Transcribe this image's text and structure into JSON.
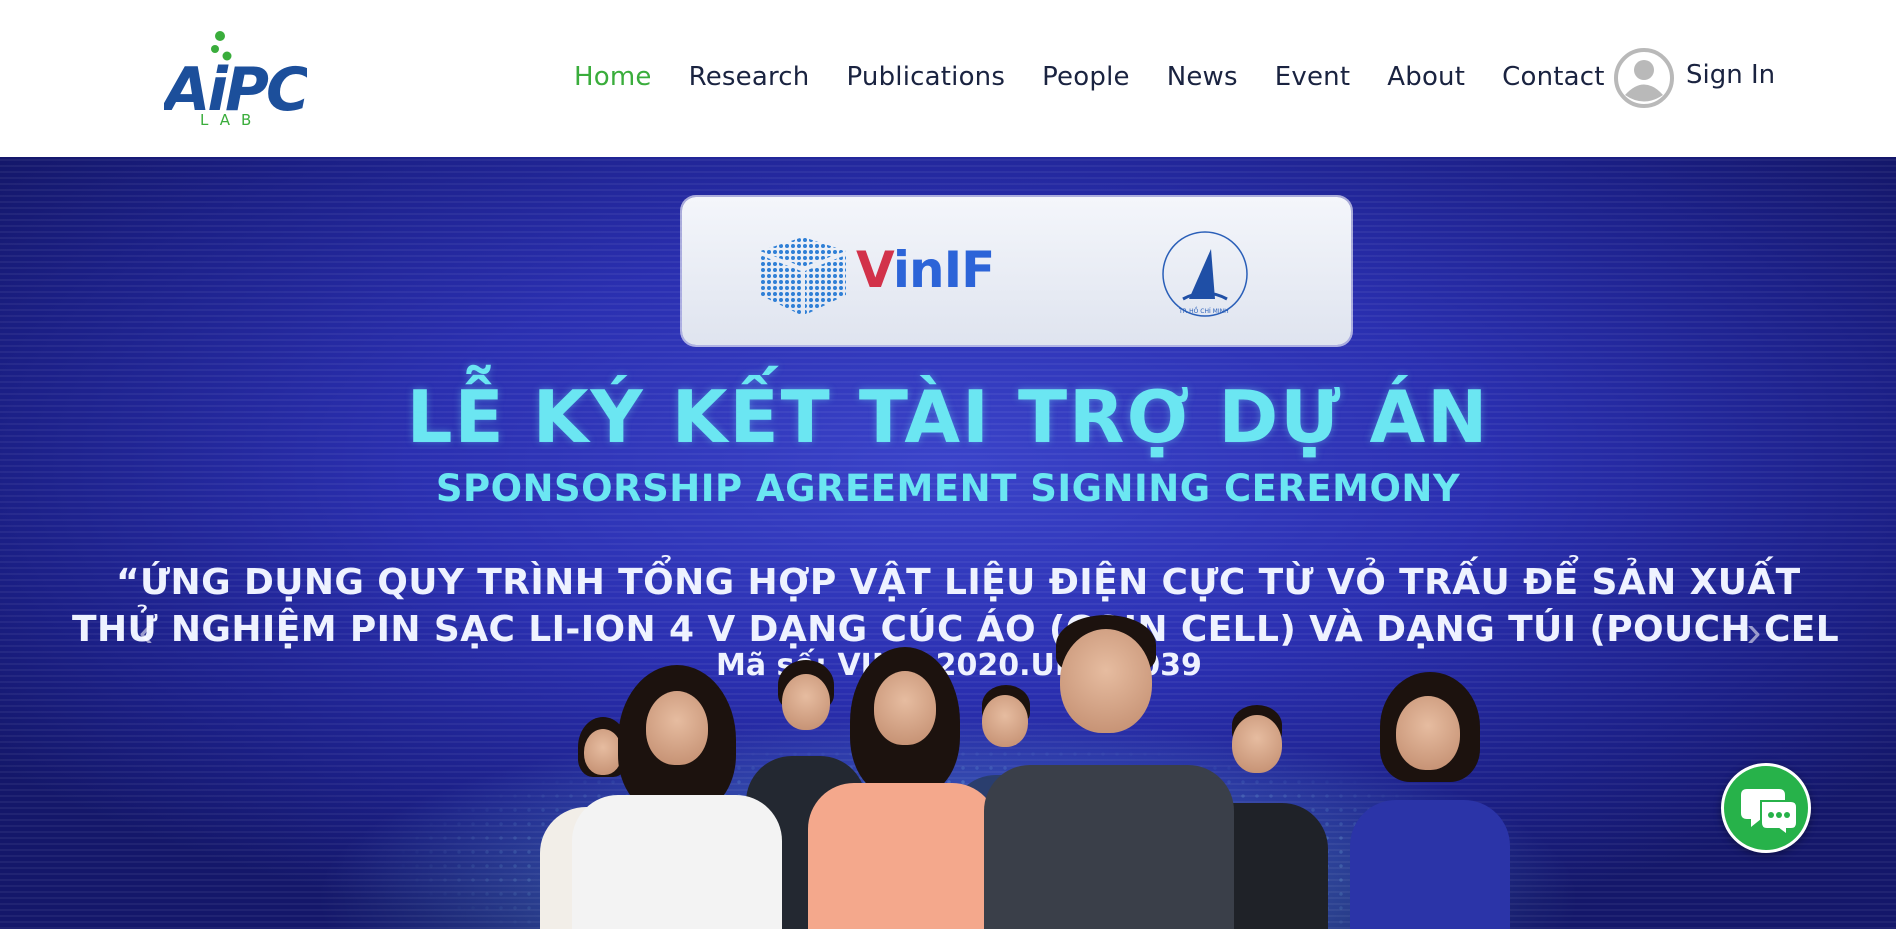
{
  "header": {
    "logo": {
      "main_text": "AiPC",
      "sub_text": "LAB",
      "icon": "aipc-lab-logo"
    },
    "nav": [
      {
        "label": "Home",
        "active": true
      },
      {
        "label": "Research",
        "active": false
      },
      {
        "label": "Publications",
        "active": false
      },
      {
        "label": "People",
        "active": false
      },
      {
        "label": "News",
        "active": false
      },
      {
        "label": "Event",
        "active": false
      },
      {
        "label": "About",
        "active": false
      },
      {
        "label": "Contact",
        "active": false
      }
    ],
    "sign_in": {
      "label": "Sign In",
      "icon": "user-avatar-icon"
    }
  },
  "hero": {
    "sponsor_logo_text": "VinIF",
    "seal_text": "TP. HỒ CHÍ MINH",
    "title": "LỄ KÝ KẾT TÀI TRỢ DỰ ÁN",
    "subtitle": "SPONSORSHIP AGREEMENT SIGNING CEREMONY",
    "project_line_1": "“ỨNG DỤNG QUY TRÌNH TỔNG HỢP VẬT LIỆU ĐIỆN CỰC TỪ VỎ TRẤU ĐỂ SẢN XUẤT",
    "project_line_2": "THỬ NGHIỆM PIN SẠC LI-ION 4 V DẠNG CÚC ÁO (COIN CELL) VÀ DẠNG TÚI (POUCH CEL",
    "project_code": "Mã số: VINIF.2020.UD.DA039",
    "prev_icon": "chevron-left-icon",
    "next_icon": "chevron-right-icon"
  },
  "chat": {
    "icon": "chat-bubble-icon"
  },
  "colors": {
    "nav_active": "#3aad3c",
    "nav_text": "#1a2340",
    "hero_title": "#6be6f2",
    "chat_button": "#27b24a"
  }
}
